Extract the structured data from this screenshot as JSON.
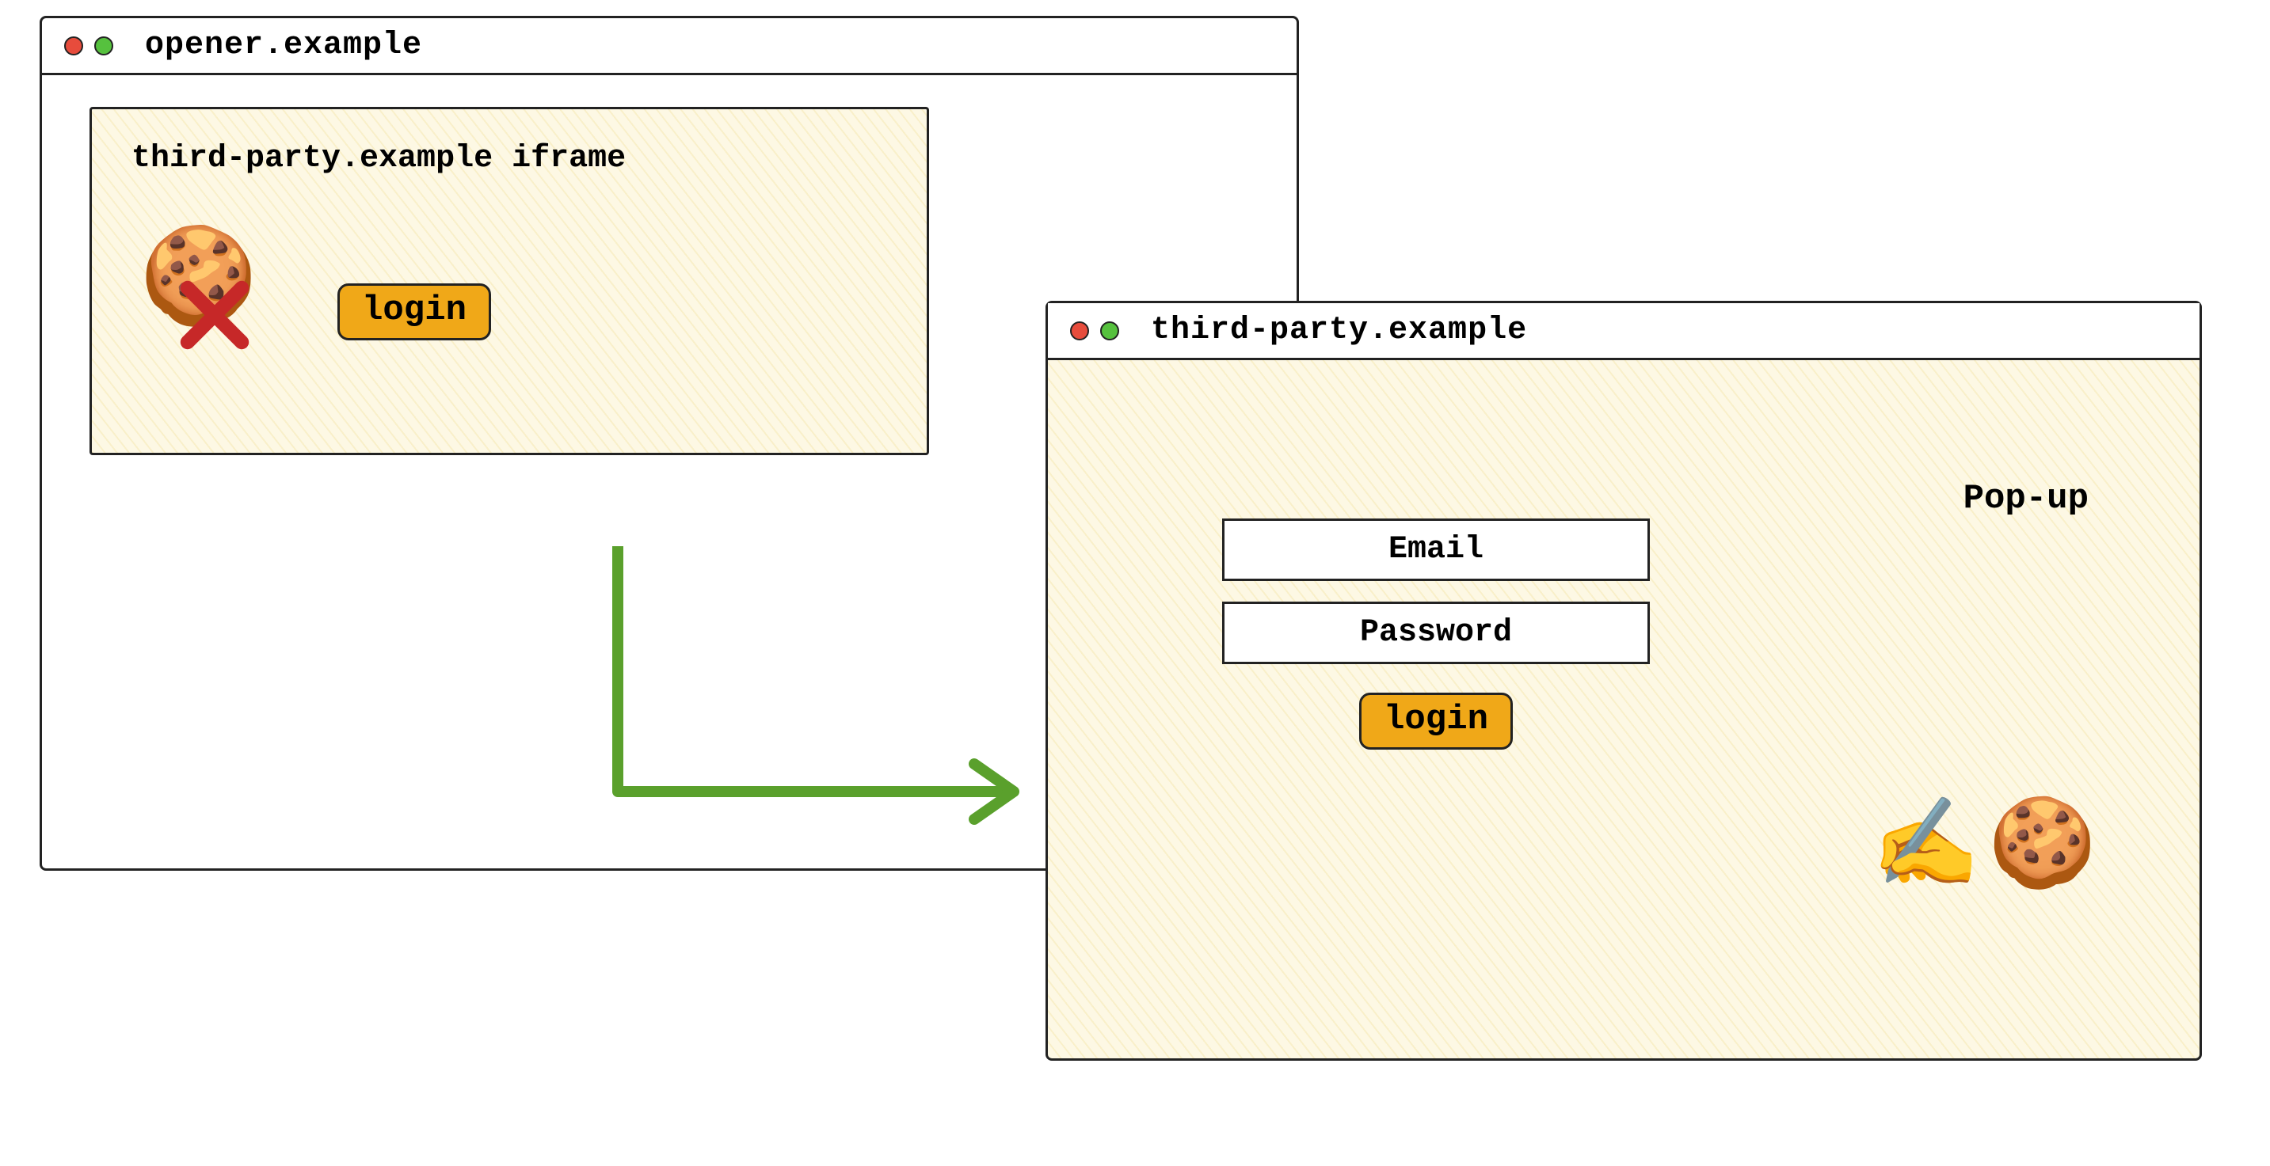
{
  "opener_window": {
    "title": "opener.example",
    "iframe": {
      "label": "third-party.example iframe",
      "login_label": "login",
      "cookie_icon": "🍪",
      "cross_icon": "cross-icon"
    }
  },
  "popup_window": {
    "title": "third-party.example",
    "label": "Pop-up",
    "email_placeholder": "Email",
    "password_placeholder": "Password",
    "login_label": "login",
    "write_icon": "✍️",
    "cookie_icon": "🍪"
  },
  "colors": {
    "accent_button": "#f0a818",
    "arrow": "#5aa02c",
    "cross": "#c62828",
    "dot_red": "#e74c3c",
    "dot_green": "#56c13e"
  }
}
